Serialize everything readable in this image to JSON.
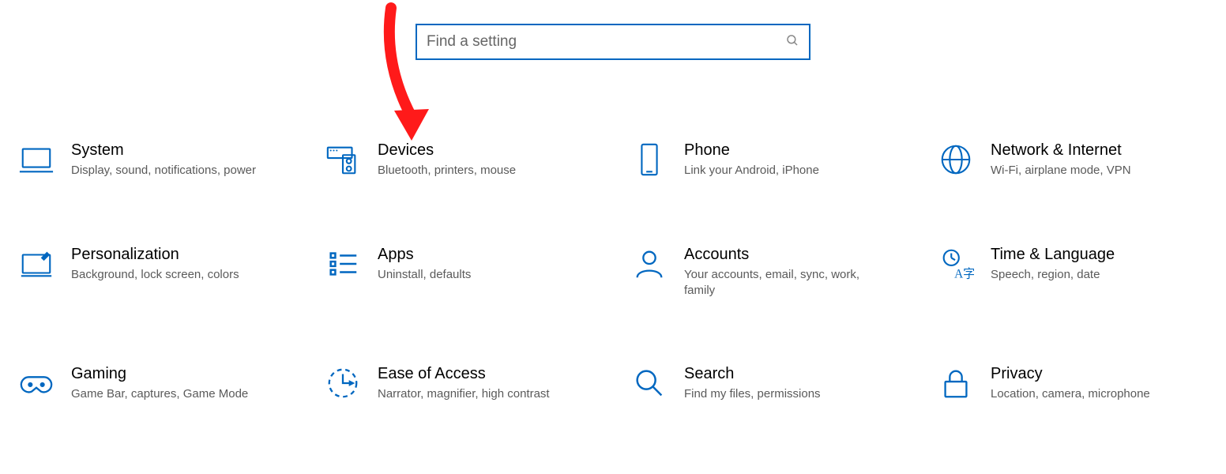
{
  "search": {
    "placeholder": "Find a setting"
  },
  "tiles": [
    {
      "title": "System",
      "desc": "Display, sound, notifications, power"
    },
    {
      "title": "Devices",
      "desc": "Bluetooth, printers, mouse"
    },
    {
      "title": "Phone",
      "desc": "Link your Android, iPhone"
    },
    {
      "title": "Network & Internet",
      "desc": "Wi-Fi, airplane mode, VPN"
    },
    {
      "title": "Personalization",
      "desc": "Background, lock screen, colors"
    },
    {
      "title": "Apps",
      "desc": "Uninstall, defaults"
    },
    {
      "title": "Accounts",
      "desc": "Your accounts, email, sync, work, family"
    },
    {
      "title": "Time & Language",
      "desc": "Speech, region, date"
    },
    {
      "title": "Gaming",
      "desc": "Game Bar, captures, Game Mode"
    },
    {
      "title": "Ease of Access",
      "desc": "Narrator, magnifier, high contrast"
    },
    {
      "title": "Search",
      "desc": "Find my files, permissions"
    },
    {
      "title": "Privacy",
      "desc": "Location, camera, microphone"
    }
  ],
  "annotation": {
    "target": "devices"
  },
  "colors": {
    "accent": "#0067c0",
    "arrow": "#ff0000"
  }
}
